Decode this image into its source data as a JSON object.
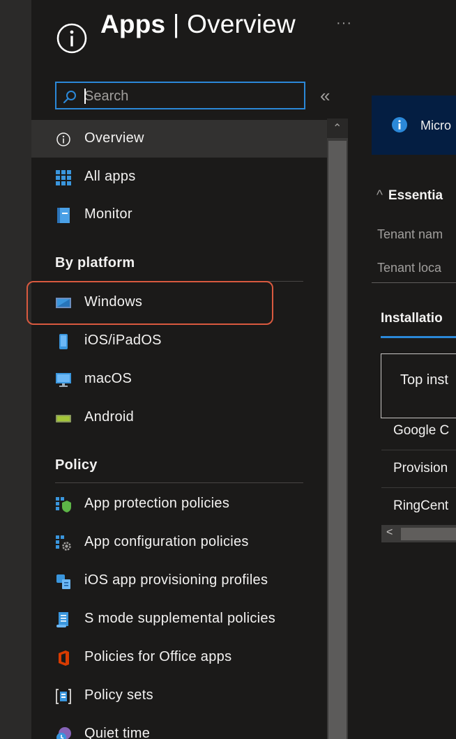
{
  "header": {
    "title_bold": "Apps",
    "title_rest": " | Overview",
    "more_label": "···"
  },
  "search": {
    "placeholder": "Search",
    "value": ""
  },
  "collapse_label": "«",
  "nav": {
    "items_top": [
      {
        "label": "Overview",
        "icon": "info-icon",
        "active": true
      },
      {
        "label": "All apps",
        "icon": "grid-icon"
      },
      {
        "label": "Monitor",
        "icon": "monitor-notebook-icon"
      }
    ],
    "sections": [
      {
        "title": "By platform",
        "items": [
          {
            "label": "Windows",
            "icon": "windows-device-icon",
            "highlighted": true
          },
          {
            "label": "iOS/iPadOS",
            "icon": "phone-icon"
          },
          {
            "label": "macOS",
            "icon": "desktop-icon"
          },
          {
            "label": "Android",
            "icon": "android-device-icon"
          }
        ]
      },
      {
        "title": "Policy",
        "items": [
          {
            "label": "App protection policies",
            "icon": "shield-grid-icon"
          },
          {
            "label": "App configuration policies",
            "icon": "gear-grid-icon"
          },
          {
            "label": "iOS app provisioning profiles",
            "icon": "provisioning-icon"
          },
          {
            "label": "S mode supplemental policies",
            "icon": "scroll-document-icon"
          },
          {
            "label": "Policies for Office apps",
            "icon": "office-icon"
          },
          {
            "label": "Policy sets",
            "icon": "policy-sets-icon"
          },
          {
            "label": "Quiet time",
            "icon": "quiet-time-icon"
          }
        ]
      }
    ]
  },
  "banner": {
    "text": "Micro"
  },
  "essentials": {
    "title": "Essentia",
    "fields": [
      "Tenant nam",
      "Tenant loca"
    ]
  },
  "tabs": {
    "active": "Installatio"
  },
  "card": {
    "title": "Top inst"
  },
  "table_rows": [
    "Google C",
    "Provision",
    "RingCent"
  ],
  "hscroll_left": "<",
  "colors": {
    "accent": "#2b88d8",
    "highlight_border": "#d9593f",
    "banner_bg": "#041e42",
    "background": "#1b1a19"
  }
}
